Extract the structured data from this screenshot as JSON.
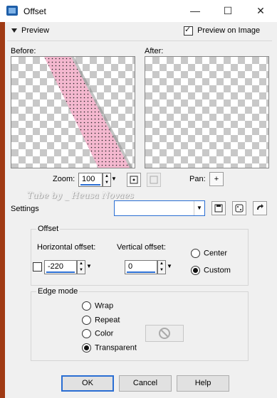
{
  "window": {
    "title": "Offset",
    "minimize": "—",
    "maximize": "☐",
    "close": "✕"
  },
  "preview_section": {
    "label": "Preview",
    "preview_on_image_label": "Preview on Image",
    "preview_on_image_checked": true
  },
  "before_label": "Before:",
  "after_label": "After:",
  "zoom": {
    "label": "Zoom:",
    "value": "100"
  },
  "pan_label": "Pan:",
  "pan_icon": "+",
  "watermark": "Tube by _ Heusa Novaes",
  "settings": {
    "label": "Settings",
    "value": ""
  },
  "offset": {
    "title": "Offset",
    "horizontal_label": "Horizontal offset:",
    "horizontal_value": "-220",
    "vertical_label": "Vertical offset:",
    "vertical_value": "0",
    "options": [
      "Center",
      "Custom"
    ],
    "selected": "Custom"
  },
  "edge_mode": {
    "title": "Edge mode",
    "options": [
      "Wrap",
      "Repeat",
      "Color",
      "Transparent"
    ],
    "selected": "Transparent"
  },
  "buttons": {
    "ok": "OK",
    "cancel": "Cancel",
    "help": "Help"
  },
  "colors": {
    "pink_stripe": "#f4b8cf",
    "accent": "#2a6ed3",
    "swatch_disabled": "#ececec"
  }
}
